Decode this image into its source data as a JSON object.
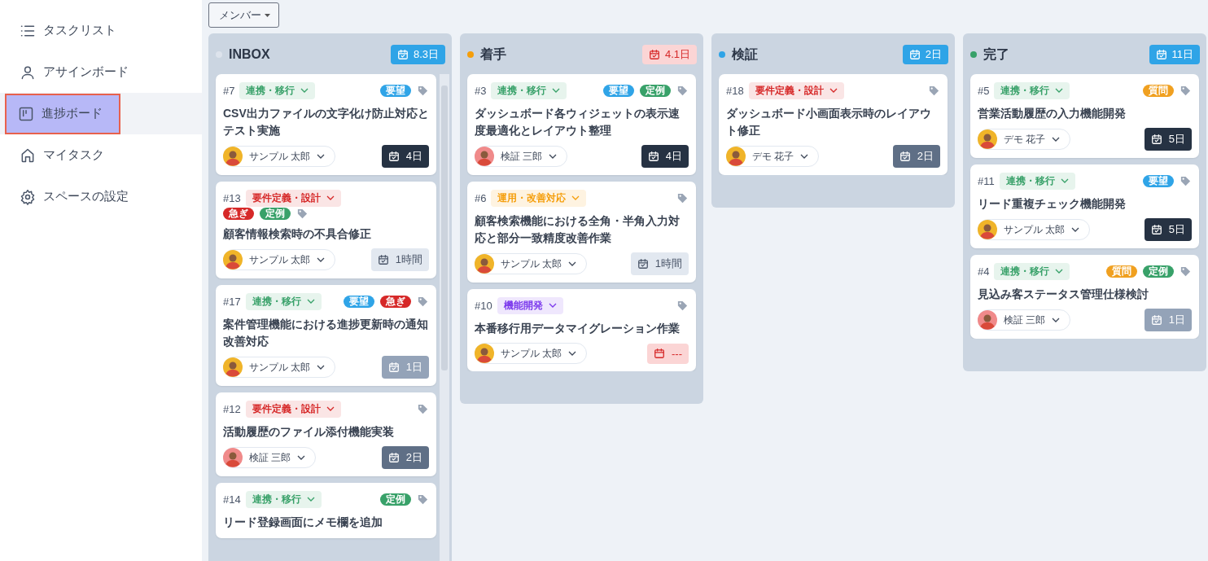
{
  "sidebar": {
    "items": [
      {
        "label": "タスクリスト",
        "selected": false
      },
      {
        "label": "アサインボード",
        "selected": false
      },
      {
        "label": "進捗ボード",
        "selected": true
      },
      {
        "label": "マイタスク",
        "selected": false
      },
      {
        "label": "スペースの設定",
        "selected": false
      }
    ]
  },
  "toolbar": {
    "member_filter": "メンバー"
  },
  "columns": [
    {
      "title": "INBOX",
      "color": "#dde3ec",
      "summary": {
        "label": "8.3日",
        "color": "#2fa4e7"
      },
      "cards": [
        {
          "number": "#7",
          "category": {
            "label": "連携・移行",
            "color": "#38a169"
          },
          "tags": [
            {
              "label": "要望",
              "color": "#2fa4e7"
            }
          ],
          "title": "CSV出力ファイルの文字化け防止対応とテスト実施",
          "assignee": {
            "name": "サンプル 太郎",
            "color": "#f0b429"
          },
          "duration": {
            "label": "4日",
            "kind": "estimate",
            "color": "#263243"
          }
        },
        {
          "number": "#13",
          "category": {
            "label": "要件定義・設計",
            "color": "#d62828"
          },
          "tags_below": true,
          "tags": [
            {
              "label": "急ぎ",
              "color": "#d62828"
            },
            {
              "label": "定例",
              "color": "#38a169"
            }
          ],
          "title": "顧客情報検索時の不具合修正",
          "assignee": {
            "name": "サンプル 太郎",
            "color": "#f0b429"
          },
          "duration": {
            "label": "1時間",
            "kind": "estimate",
            "color": "#e2e8f0"
          }
        },
        {
          "number": "#17",
          "category": {
            "label": "連携・移行",
            "color": "#38a169"
          },
          "tags": [
            {
              "label": "要望",
              "color": "#2fa4e7"
            },
            {
              "label": "急ぎ",
              "color": "#d62828"
            }
          ],
          "title": "案件管理機能における進捗更新時の通知改善対応",
          "assignee": {
            "name": "サンプル 太郎",
            "color": "#f0b429"
          },
          "duration": {
            "label": "1日",
            "kind": "estimate",
            "color": "#94a3b8"
          }
        },
        {
          "number": "#12",
          "category": {
            "label": "要件定義・設計",
            "color": "#d62828"
          },
          "title": "活動履歴のファイル添付機能実装",
          "assignee": {
            "name": "検証 三郎",
            "color": "#f08a8a"
          },
          "duration": {
            "label": "2日",
            "kind": "estimate",
            "color": "#5f6f86"
          }
        },
        {
          "number": "#14",
          "category": {
            "label": "連携・移行",
            "color": "#38a169"
          },
          "tags": [
            {
              "label": "定例",
              "color": "#38a169"
            }
          ],
          "title": "リード登録画面にメモ欄を追加"
        }
      ]
    },
    {
      "title": "着手",
      "color": "#f59e0b",
      "summary": {
        "label": "4.1日",
        "color": "#fbd5d5"
      },
      "cards": [
        {
          "number": "#3",
          "category": {
            "label": "連携・移行",
            "color": "#38a169"
          },
          "tags": [
            {
              "label": "要望",
              "color": "#2fa4e7"
            },
            {
              "label": "定例",
              "color": "#38a169"
            }
          ],
          "title": "ダッシュボード各ウィジェットの表示速度最適化とレイアウト整理",
          "assignee": {
            "name": "検証 三郎",
            "color": "#f08a8a"
          },
          "duration": {
            "label": "4日",
            "kind": "estimate",
            "color": "#263243"
          }
        },
        {
          "number": "#6",
          "category": {
            "label": "運用・改善対応",
            "color": "#f59e0b"
          },
          "title": "顧客検索機能における全角・半角入力対応と部分一致精度改善作業",
          "assignee": {
            "name": "サンプル 太郎",
            "color": "#f0b429"
          },
          "duration": {
            "label": "1時間",
            "kind": "estimate",
            "color": "#e2e8f0"
          }
        },
        {
          "number": "#10",
          "category": {
            "label": "機能開発",
            "color": "#7c3aed"
          },
          "title": "本番移行用データマイグレーション作業",
          "assignee": {
            "name": "サンプル 太郎",
            "color": "#f0b429"
          },
          "duration": {
            "label": "---",
            "kind": "overdue",
            "color": "#fbd5d5"
          }
        }
      ]
    },
    {
      "title": "検証",
      "color": "#2fa4e7",
      "summary": {
        "label": "2日",
        "color": "#2fa4e7"
      },
      "cards": [
        {
          "number": "#18",
          "category": {
            "label": "要件定義・設計",
            "color": "#d62828"
          },
          "title": "ダッシュボード小画面表示時のレイアウト修正",
          "assignee": {
            "name": "デモ 花子",
            "color": "#f0b429"
          },
          "duration": {
            "label": "2日",
            "kind": "estimate",
            "color": "#5f6f86"
          }
        }
      ]
    },
    {
      "title": "完了",
      "color": "#38a169",
      "summary": {
        "label": "11日",
        "color": "#2fa4e7"
      },
      "cards": [
        {
          "number": "#5",
          "category": {
            "label": "連携・移行",
            "color": "#38a169"
          },
          "tags": [
            {
              "label": "質問",
              "color": "#f0a020"
            }
          ],
          "title": "営業活動履歴の入力機能開発",
          "assignee": {
            "name": "デモ 花子",
            "color": "#f0b429"
          },
          "duration": {
            "label": "5日",
            "kind": "estimate",
            "color": "#263243"
          }
        },
        {
          "number": "#11",
          "category": {
            "label": "連携・移行",
            "color": "#38a169"
          },
          "tags": [
            {
              "label": "要望",
              "color": "#2fa4e7"
            }
          ],
          "title": "リード重複チェック機能開発",
          "assignee": {
            "name": "サンプル 太郎",
            "color": "#f0b429"
          },
          "duration": {
            "label": "5日",
            "kind": "estimate",
            "color": "#263243"
          }
        },
        {
          "number": "#4",
          "category": {
            "label": "連携・移行",
            "color": "#38a169"
          },
          "tags": [
            {
              "label": "質問",
              "color": "#f0a020"
            },
            {
              "label": "定例",
              "color": "#38a169"
            }
          ],
          "title": "見込み客ステータス管理仕様検討",
          "assignee": {
            "name": "検証 三郎",
            "color": "#f08a8a"
          },
          "duration": {
            "label": "1日",
            "kind": "estimate",
            "color": "#94a3b8"
          }
        }
      ]
    }
  ]
}
